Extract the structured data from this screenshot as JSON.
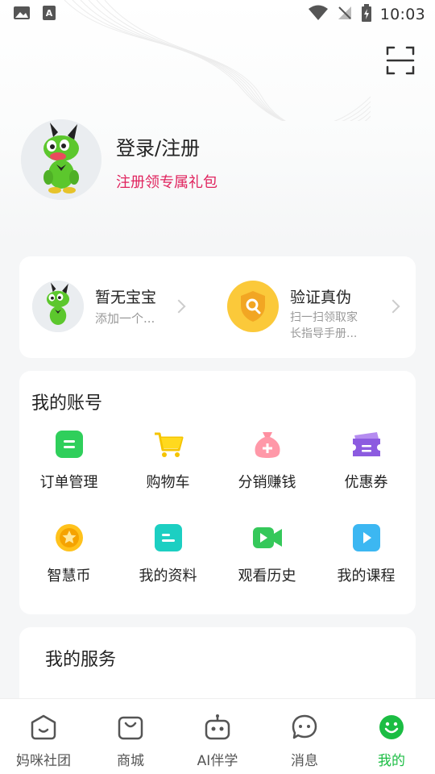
{
  "status_bar": {
    "time": "10:03",
    "left_icons": [
      "image-icon",
      "accessibility-icon"
    ],
    "right_icons": [
      "wifi-icon",
      "no-signal-icon",
      "battery-charging-icon"
    ]
  },
  "header": {
    "scan_icon": "scan-icon"
  },
  "profile": {
    "title": "登录/注册",
    "subtitle": "注册领专属礼包",
    "subtitle_color": "#e0245e"
  },
  "baby_card": {
    "baby": {
      "title": "暂无宝宝",
      "subtitle": "添加一个..."
    },
    "verify": {
      "title": "验证真伪",
      "subtitle": "扫一扫领取家长指导手册..."
    }
  },
  "account": {
    "title": "我的账号",
    "items": [
      {
        "label": "订单管理",
        "icon": "order-icon"
      },
      {
        "label": "购物车",
        "icon": "cart-icon"
      },
      {
        "label": "分销赚钱",
        "icon": "money-bag-icon"
      },
      {
        "label": "优惠券",
        "icon": "coupon-icon"
      },
      {
        "label": "智慧币",
        "icon": "coin-icon"
      },
      {
        "label": "我的资料",
        "icon": "profile-doc-icon"
      },
      {
        "label": "观看历史",
        "icon": "video-icon"
      },
      {
        "label": "我的课程",
        "icon": "course-icon"
      }
    ]
  },
  "service": {
    "title": "我的服务"
  },
  "tabs": [
    {
      "label": "妈咪社团",
      "icon": "community-icon",
      "active": false
    },
    {
      "label": "商城",
      "icon": "shop-bag-icon",
      "active": false
    },
    {
      "label": "AI伴学",
      "icon": "robot-icon",
      "active": false
    },
    {
      "label": "消息",
      "icon": "message-icon",
      "active": false
    },
    {
      "label": "我的",
      "icon": "smile-icon",
      "active": true
    }
  ],
  "colors": {
    "accent": "#1bbd43",
    "background": "#f5f6f7",
    "card": "#ffffff"
  }
}
